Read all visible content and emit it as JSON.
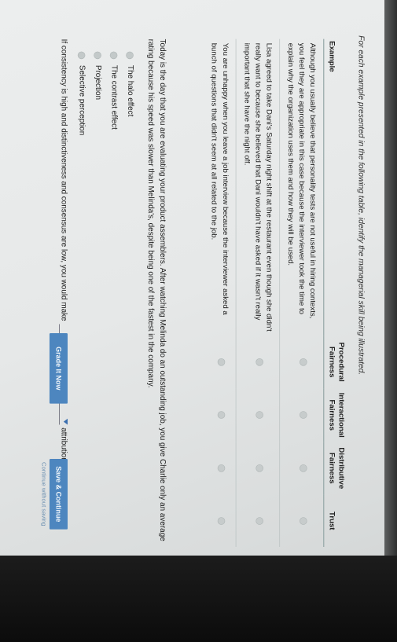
{
  "instruction": "For each example presented in the following table, identify the managerial skill being illustrated.",
  "table": {
    "headers": {
      "example": "Example",
      "procedural_1": "Procedural",
      "procedural_2": "Fairness",
      "interactional_1": "Interactional",
      "interactional_2": "Fairness",
      "distributive_1": "Distributive",
      "distributive_2": "Fairness",
      "trust": "Trust"
    },
    "rows": [
      {
        "example": "Although you usually believe that personality tests are not useful in hiring contexts, you feel they are appropriate in this case because the interviewer took the time to explain why the organization uses them and how they will be used."
      },
      {
        "example": "Lisa agreed to take Dani's Saturday night shift at the restaurant even though she didn't really want to because she believed that Dani wouldn't have asked if it wasn't really important that she have the night off."
      },
      {
        "example": "You are unhappy when you leave a job interview because the interviewer asked a bunch of questions that didn't seem at all related to the job."
      }
    ]
  },
  "scenario": "Today is the day that you are evaluating your product assemblers. After watching Melinda do an outstanding job, you give Charlie only an average rating because his speed was slower than Melinda's, despite being one of the fastest in the company.",
  "choices": [
    "The halo effect",
    "The contrast effect",
    "Projection",
    "Selective perception"
  ],
  "completion": {
    "prefix": "If consistency is high and distinctiveness and consensus are low, you would make",
    "suffix": "attributions."
  },
  "buttons": {
    "grade": "Grade It Now",
    "save": "Save & Continue",
    "continue_link": "Continue without saving"
  }
}
